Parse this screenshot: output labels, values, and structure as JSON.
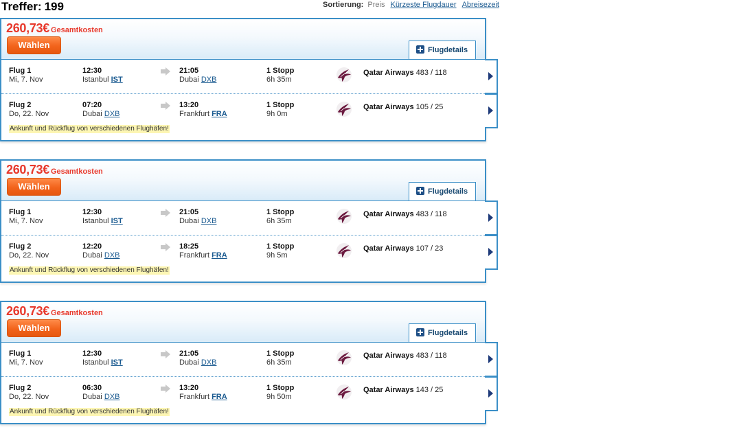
{
  "header": {
    "hits_label": "Treffer:",
    "hits_count": "199",
    "sort_label": "Sortierung:",
    "sort_price": "Preis",
    "sort_shortest": "Kürzeste Flugdauer",
    "sort_departure": "Abreisezeit"
  },
  "colors": {
    "price": "#e8392c",
    "accent_border": "#3b8fc7",
    "button_orange": "#f2631b",
    "notice_bg": "#fdf6b3"
  },
  "results": [
    {
      "price": "260,73€",
      "price_label": "Gesamtkosten",
      "select_label": "Wählen",
      "details_label": "Flugdetails",
      "notice": "Ankunft und Rückflug von verschiedenen Flughäfen!",
      "flights": [
        {
          "name": "Flug 1",
          "date": "Mi, 7. Nov",
          "dep_time": "12:30",
          "dep_city": "Istanbul",
          "dep_code": "IST",
          "arr_time": "21:05",
          "arr_city": "Dubai",
          "arr_code": "DXB",
          "stops": "1 Stopp",
          "duration": "6h 35m",
          "airline": "Qatar Airways",
          "flight_numbers": "483 / 118",
          "logo_icon": "qatar-airways-logo-icon"
        },
        {
          "name": "Flug 2",
          "date": "Do, 22. Nov",
          "dep_time": "07:20",
          "dep_city": "Dubai",
          "dep_code": "DXB",
          "arr_time": "13:20",
          "arr_city": "Frankfurt",
          "arr_code": "FRA",
          "stops": "1 Stopp",
          "duration": "9h 0m",
          "airline": "Qatar Airways",
          "flight_numbers": "105 / 25",
          "logo_icon": "qatar-airways-logo-icon"
        }
      ]
    },
    {
      "price": "260,73€",
      "price_label": "Gesamtkosten",
      "select_label": "Wählen",
      "details_label": "Flugdetails",
      "notice": "Ankunft und Rückflug von verschiedenen Flughäfen!",
      "flights": [
        {
          "name": "Flug 1",
          "date": "Mi, 7. Nov",
          "dep_time": "12:30",
          "dep_city": "Istanbul",
          "dep_code": "IST",
          "arr_time": "21:05",
          "arr_city": "Dubai",
          "arr_code": "DXB",
          "stops": "1 Stopp",
          "duration": "6h 35m",
          "airline": "Qatar Airways",
          "flight_numbers": "483 / 118",
          "logo_icon": "qatar-airways-logo-icon"
        },
        {
          "name": "Flug 2",
          "date": "Do, 22. Nov",
          "dep_time": "12:20",
          "dep_city": "Dubai",
          "dep_code": "DXB",
          "arr_time": "18:25",
          "arr_city": "Frankfurt",
          "arr_code": "FRA",
          "stops": "1 Stopp",
          "duration": "9h 5m",
          "airline": "Qatar Airways",
          "flight_numbers": "107 / 23",
          "logo_icon": "qatar-airways-logo-icon"
        }
      ]
    },
    {
      "price": "260,73€",
      "price_label": "Gesamtkosten",
      "select_label": "Wählen",
      "details_label": "Flugdetails",
      "notice": "Ankunft und Rückflug von verschiedenen Flughäfen!",
      "flights": [
        {
          "name": "Flug 1",
          "date": "Mi, 7. Nov",
          "dep_time": "12:30",
          "dep_city": "Istanbul",
          "dep_code": "IST",
          "arr_time": "21:05",
          "arr_city": "Dubai",
          "arr_code": "DXB",
          "stops": "1 Stopp",
          "duration": "6h 35m",
          "airline": "Qatar Airways",
          "flight_numbers": "483 / 118",
          "logo_icon": "qatar-airways-logo-icon"
        },
        {
          "name": "Flug 2",
          "date": "Do, 22. Nov",
          "dep_time": "06:30",
          "dep_city": "Dubai",
          "dep_code": "DXB",
          "arr_time": "13:20",
          "arr_city": "Frankfurt",
          "arr_code": "FRA",
          "stops": "1 Stopp",
          "duration": "9h 50m",
          "airline": "Qatar Airways",
          "flight_numbers": "143 / 25",
          "logo_icon": "qatar-airways-logo-icon"
        }
      ]
    }
  ]
}
